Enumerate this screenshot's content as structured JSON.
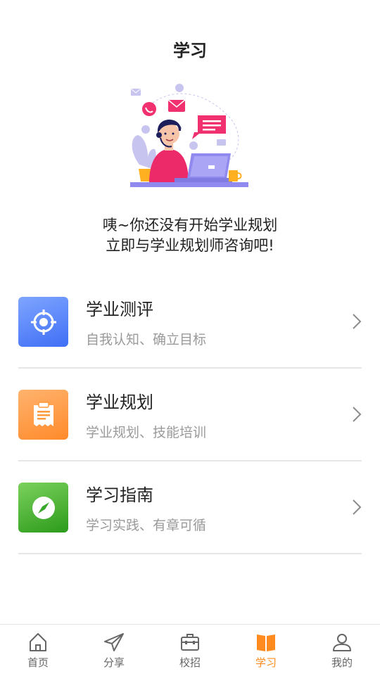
{
  "header": {
    "title": "学习"
  },
  "empty_state": {
    "line1": "咦~你还没有开始学业规划",
    "line2": "立即与学业规划师咨询吧!"
  },
  "menu": [
    {
      "title": "学业测评",
      "subtitle": "自我认知、确立目标",
      "icon": "target-icon",
      "color": "#4f7ff7"
    },
    {
      "title": "学业规划",
      "subtitle": "学业规划、技能培训",
      "icon": "clipboard-icon",
      "color": "#ff9a3c"
    },
    {
      "title": "学习指南",
      "subtitle": "学习实践、有章可循",
      "icon": "compass-icon",
      "color": "#3aa82a"
    }
  ],
  "tabbar": {
    "active": "学习",
    "active_color": "#ff8b1e",
    "items": [
      {
        "label": "首页",
        "icon": "home-icon"
      },
      {
        "label": "分享",
        "icon": "send-icon"
      },
      {
        "label": "校招",
        "icon": "briefcase-icon"
      },
      {
        "label": "学习",
        "icon": "book-icon"
      },
      {
        "label": "我的",
        "icon": "user-icon"
      }
    ]
  }
}
